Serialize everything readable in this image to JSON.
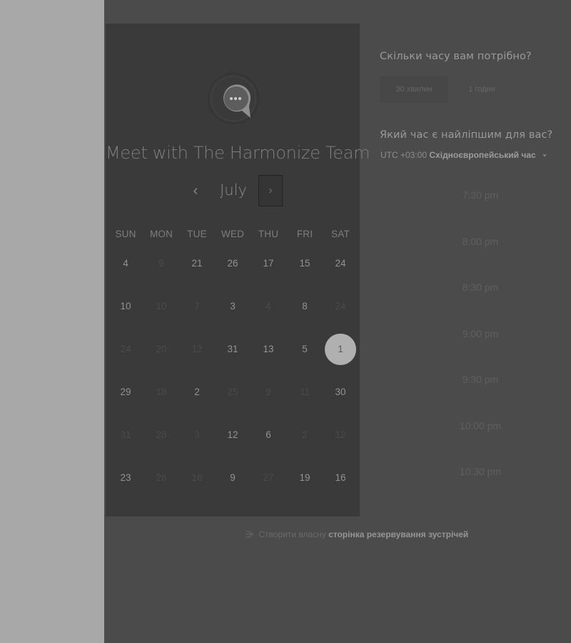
{
  "meeting": {
    "title": "Meet with The Harmonize Team"
  },
  "calendar": {
    "month": "July",
    "prev_icon": "‹",
    "next_icon": "›",
    "weekdays": [
      "SUN",
      "MON",
      "TUE",
      "WED",
      "THU",
      "FRI",
      "SAT"
    ],
    "weeks": [
      [
        {
          "d": "4",
          "on": true
        },
        {
          "d": "9",
          "on": false
        },
        {
          "d": "21",
          "on": true
        },
        {
          "d": "26",
          "on": true
        },
        {
          "d": "17",
          "on": true
        },
        {
          "d": "15",
          "on": true
        },
        {
          "d": "24",
          "on": true
        }
      ],
      [
        {
          "d": "10",
          "on": true
        },
        {
          "d": "10",
          "on": false
        },
        {
          "d": "7",
          "on": false
        },
        {
          "d": "3",
          "on": true
        },
        {
          "d": "4",
          "on": false
        },
        {
          "d": "8",
          "on": true
        },
        {
          "d": "24",
          "on": false
        }
      ],
      [
        {
          "d": "24",
          "on": false
        },
        {
          "d": "20",
          "on": false
        },
        {
          "d": "12",
          "on": false
        },
        {
          "d": "31",
          "on": true
        },
        {
          "d": "13",
          "on": true
        },
        {
          "d": "5",
          "on": true
        },
        {
          "d": "1",
          "on": true,
          "selected": true
        }
      ],
      [
        {
          "d": "29",
          "on": true
        },
        {
          "d": "18",
          "on": false
        },
        {
          "d": "2",
          "on": true
        },
        {
          "d": "25",
          "on": false
        },
        {
          "d": "9",
          "on": false
        },
        {
          "d": "11",
          "on": false
        },
        {
          "d": "30",
          "on": true
        }
      ],
      [
        {
          "d": "31",
          "on": false
        },
        {
          "d": "28",
          "on": false
        },
        {
          "d": "3",
          "on": false
        },
        {
          "d": "12",
          "on": true
        },
        {
          "d": "6",
          "on": true
        },
        {
          "d": "2",
          "on": false
        },
        {
          "d": "12",
          "on": false
        }
      ],
      [
        {
          "d": "23",
          "on": true
        },
        {
          "d": "26",
          "on": false
        },
        {
          "d": "16",
          "on": false
        },
        {
          "d": "9",
          "on": true
        },
        {
          "d": "27",
          "on": false
        },
        {
          "d": "19",
          "on": true
        },
        {
          "d": "16",
          "on": true
        }
      ]
    ]
  },
  "duration": {
    "question": "Скільки часу вам потрібно?",
    "options": [
      "30 хвилин",
      "1 годин"
    ]
  },
  "timezone": {
    "question": "Який час є найліпшим для вас?",
    "offset": "UTC +03:00",
    "name": "Східноєвропейський час"
  },
  "time_slots": [
    "7:30 pm",
    "8:00 pm",
    "8:30 pm",
    "9:00 pm",
    "9:30 pm",
    "10:00 pm",
    "10:30 pm"
  ],
  "footer": {
    "icon": "⋺",
    "prefix": "Створити власну",
    "link": "сторінка резервування зустрічей"
  },
  "colors": {
    "page_bg": "#4b4b4b",
    "left_gutter": "#a8a8a8",
    "panel_bg": "#3a3a3a",
    "selected_day": "#b0b0b0"
  }
}
